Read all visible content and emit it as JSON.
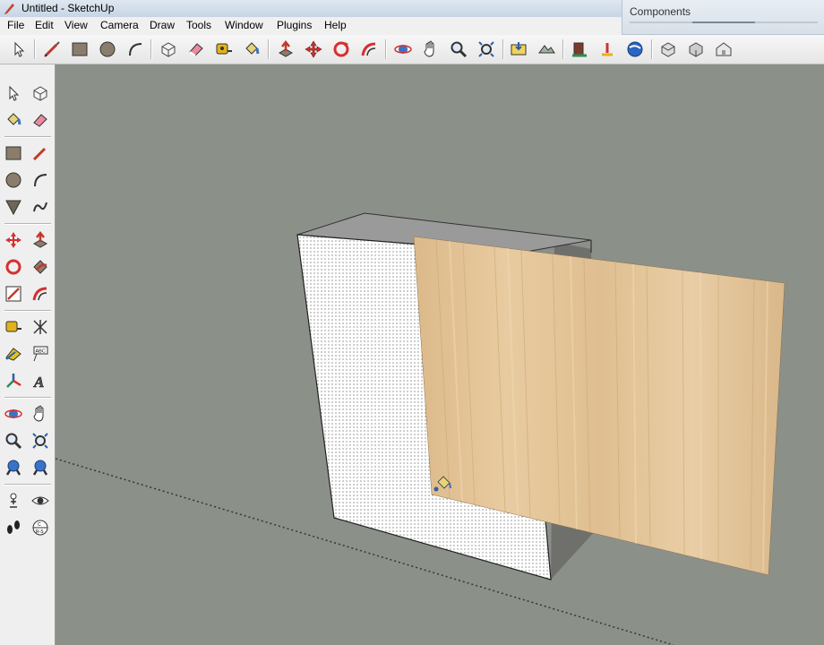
{
  "window": {
    "title": "Untitled - SketchUp"
  },
  "menu": [
    "File",
    "Edit",
    "View",
    "Camera",
    "Draw",
    "Tools",
    "Window",
    "Plugins",
    "Help"
  ],
  "components_panel": {
    "title": "Components"
  },
  "toolbar": {
    "icons": [
      "select-icon",
      "line-icon",
      "rectangle-icon",
      "circle-icon",
      "arc-icon",
      "make-component-icon",
      "eraser-icon",
      "tape-measure-icon",
      "paint-bucket-icon",
      "push-pull-icon",
      "move-icon",
      "rotate-icon",
      "follow-me-icon",
      "orbit-icon",
      "pan-icon",
      "zoom-icon",
      "zoom-extents-icon",
      "add-location-icon",
      "toggle-terrain-icon",
      "get-models-icon",
      "share-model-icon",
      "place-model-icon",
      "google-earth-icon",
      "components-get-icon",
      "components-share-icon",
      "warehouse-icon"
    ]
  },
  "colors": {
    "viewport_background": "#8b9089",
    "box_front_face": "#ffffff",
    "box_top_face": "#9a9a9a",
    "box_side_face": "#6f706c",
    "wood_texture": "#e4c69c",
    "axis_dotted": "#2f3a2f"
  },
  "left_toolbar": {
    "icons": [
      "select-icon",
      "make-component-icon",
      "paint-bucket-icon",
      "eraser-icon",
      "rectangle-icon",
      "line-icon",
      "circle-icon",
      "arc-icon",
      "polygon-icon",
      "freehand-icon",
      "move-icon",
      "push-pull-icon",
      "rotate-icon",
      "follow-me-icon",
      "scale-icon",
      "offset-icon",
      "tape-measure-icon",
      "dimension-icon",
      "protractor-icon",
      "text-icon",
      "axes-icon",
      "3d-text-icon",
      "orbit-icon",
      "pan-icon",
      "zoom-icon",
      "zoom-window-icon",
      "previous-view-icon",
      "next-view-icon",
      "position-camera-icon",
      "look-around-icon",
      "walk-icon",
      "section-plane-icon"
    ]
  },
  "scene": {
    "cursor": "paint-bucket-cursor"
  }
}
